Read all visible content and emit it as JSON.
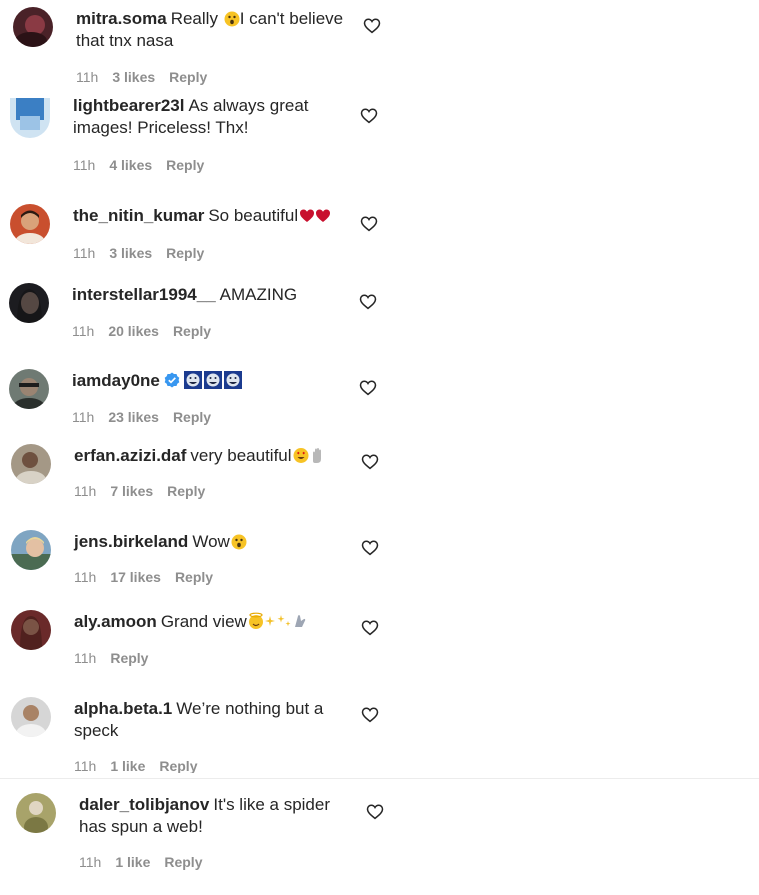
{
  "comments": [
    {
      "username": "mitra.soma",
      "text": "Really",
      "text2": "I can't believe that tnx nasa",
      "time": "11h",
      "likes": "3 likes",
      "reply": "Reply"
    },
    {
      "username": "lightbearer23l",
      "text": "As always great images! Priceless! Thx!",
      "time": "11h",
      "likes": "4 likes",
      "reply": "Reply"
    },
    {
      "username": "the_nitin_kumar",
      "text": "So beautiful",
      "time": "11h",
      "likes": "3 likes",
      "reply": "Reply"
    },
    {
      "username": "interstellar1994__",
      "text": "AMAZING",
      "time": "11h",
      "likes": "20 likes",
      "reply": "Reply"
    },
    {
      "username": "iamday0ne",
      "text": "",
      "time": "11h",
      "likes": "23 likes",
      "reply": "Reply"
    },
    {
      "username": "erfan.azizi.daf",
      "text": "very beautiful",
      "time": "11h",
      "likes": "7 likes",
      "reply": "Reply"
    },
    {
      "username": "jens.birkeland",
      "text": "Wow",
      "time": "11h",
      "likes": "17 likes",
      "reply": "Reply"
    },
    {
      "username": "aly.amoon",
      "text": "Grand view",
      "time": "11h",
      "likes": "",
      "reply": "Reply"
    },
    {
      "username": "alpha.beta.1",
      "text": "We’re nothing but a speck",
      "time": "11h",
      "likes": "1 like",
      "reply": "Reply"
    },
    {
      "username": "daler_tolibjanov",
      "text": "It's like a spider has spun a web!",
      "time": "11h",
      "likes": "1 like",
      "reply": "Reply"
    }
  ],
  "icons": {
    "like": "heart-outline-icon",
    "verified": "verified-badge-icon"
  },
  "colors": {
    "text": "#262626",
    "meta": "#8e8e8e",
    "verified": "#3897f0",
    "heart_emoji": "#c8102e"
  }
}
